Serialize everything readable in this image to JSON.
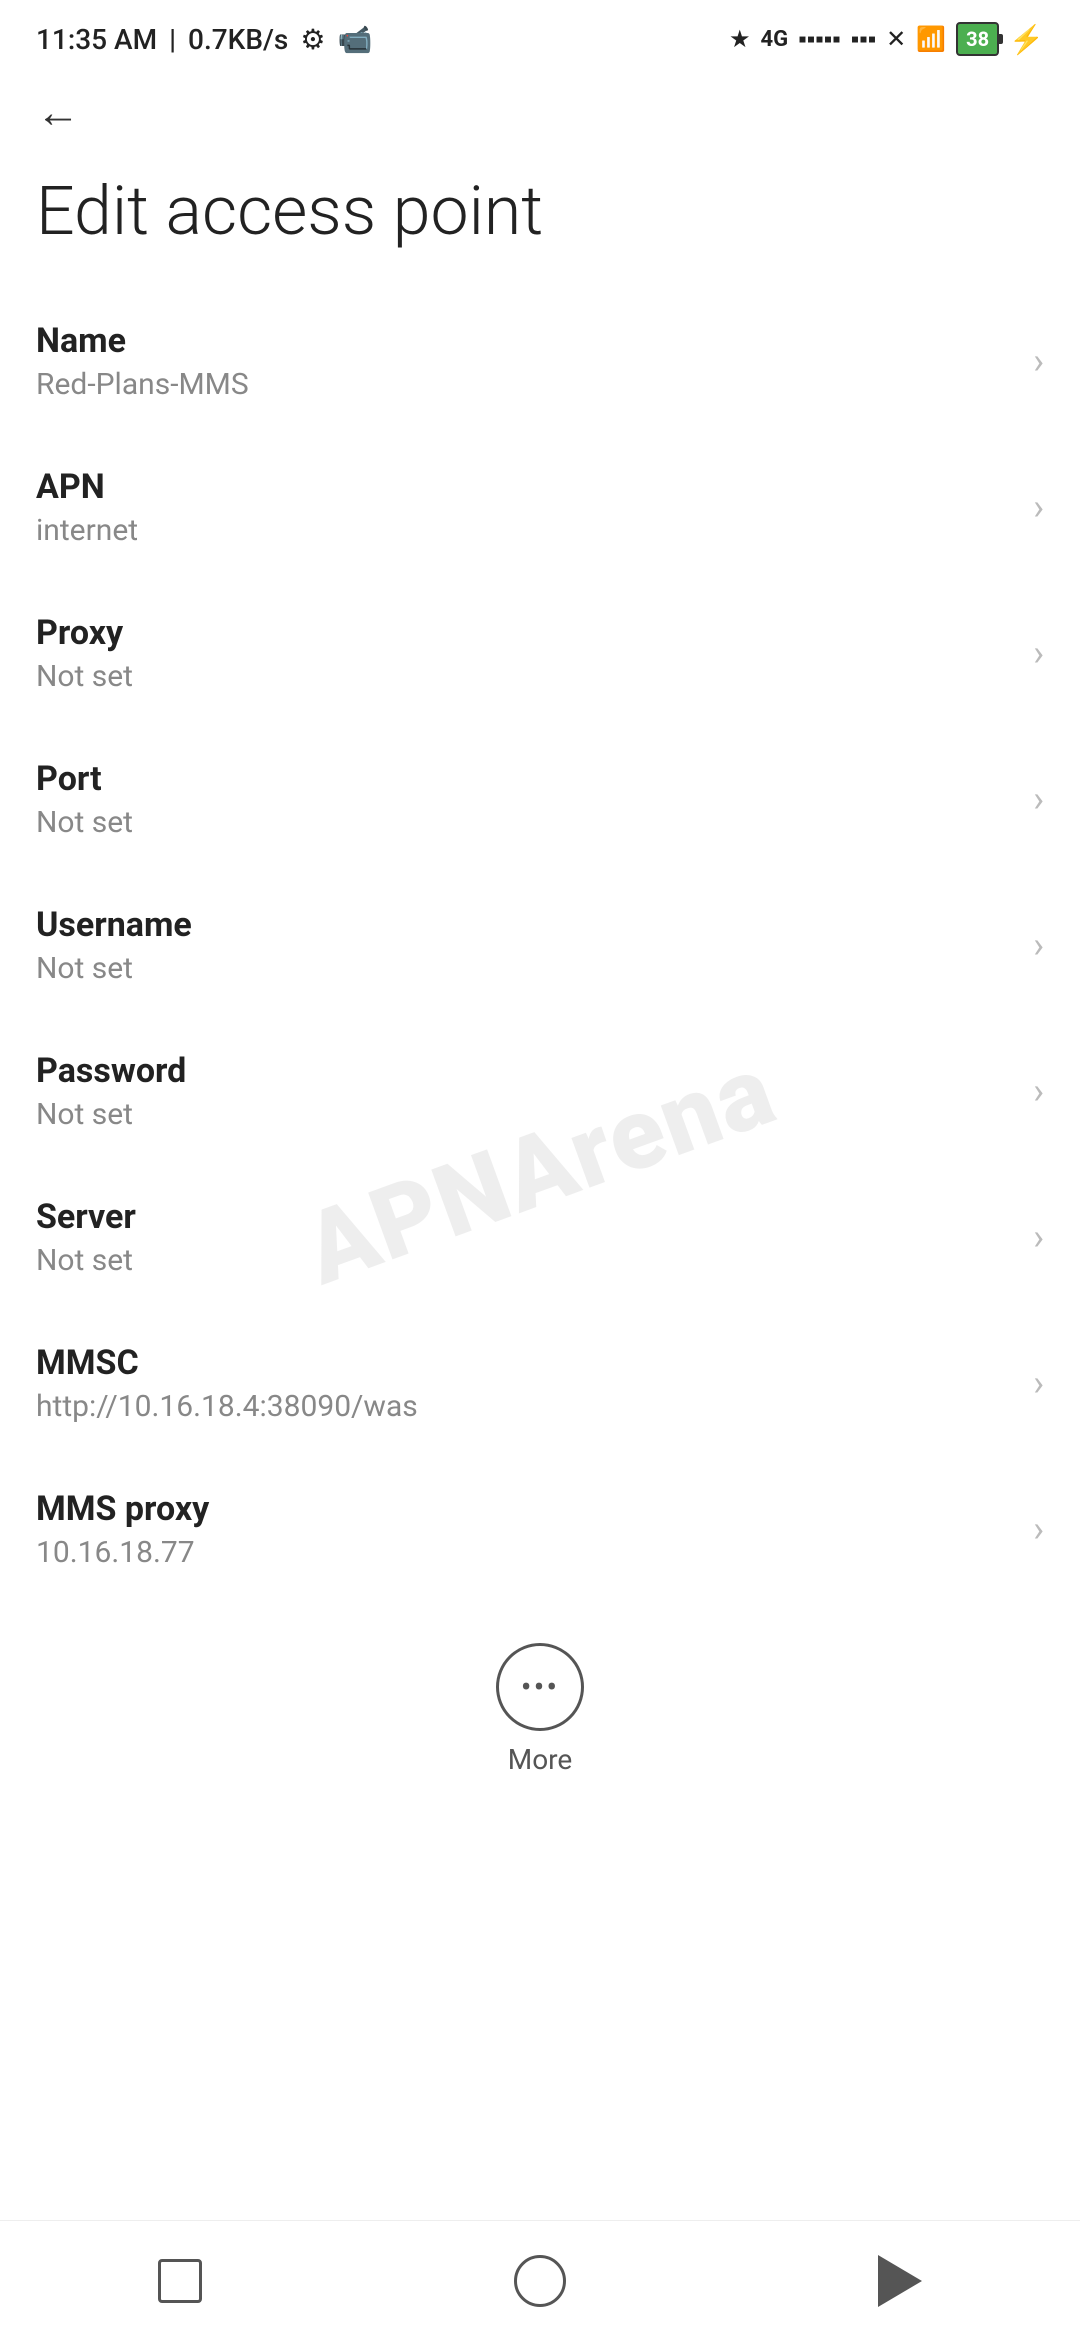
{
  "statusBar": {
    "time": "11:35 AM",
    "speed": "0.7KB/s",
    "battery": "38"
  },
  "header": {
    "backLabel": "←",
    "title": "Edit access point"
  },
  "watermark": "APNArena",
  "settings": [
    {
      "label": "Name",
      "value": "Red-Plans-MMS"
    },
    {
      "label": "APN",
      "value": "internet"
    },
    {
      "label": "Proxy",
      "value": "Not set"
    },
    {
      "label": "Port",
      "value": "Not set"
    },
    {
      "label": "Username",
      "value": "Not set"
    },
    {
      "label": "Password",
      "value": "Not set"
    },
    {
      "label": "Server",
      "value": "Not set"
    },
    {
      "label": "MMSC",
      "value": "http://10.16.18.4:38090/was"
    },
    {
      "label": "MMS proxy",
      "value": "10.16.18.77"
    }
  ],
  "more": {
    "label": "More"
  },
  "navbar": {
    "square": "recent-apps",
    "circle": "home",
    "triangle": "back"
  }
}
